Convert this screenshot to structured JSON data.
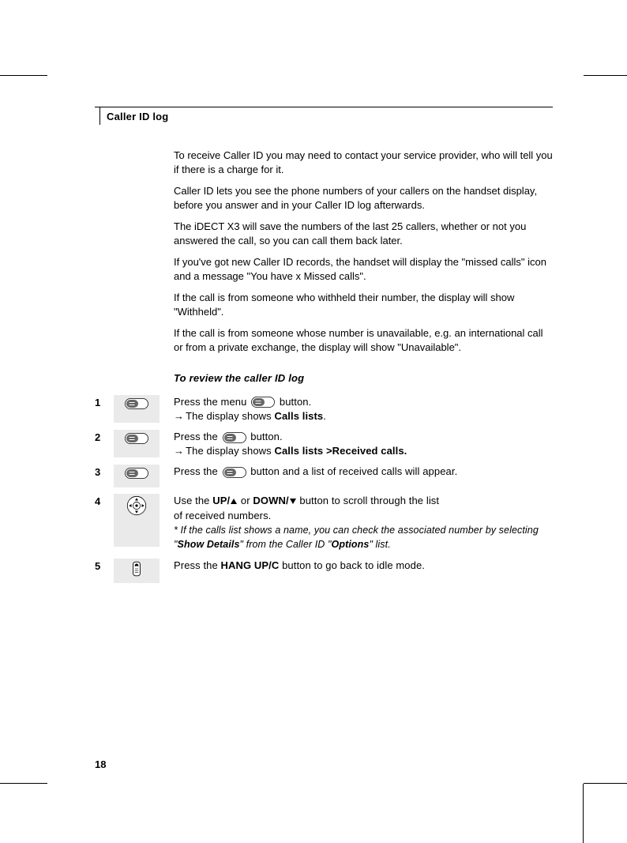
{
  "header": {
    "title": "Caller ID log"
  },
  "intro": {
    "p1": "To receive Caller ID you may need to contact your service provider, who will tell you if there is a charge for it.",
    "p2": "Caller ID lets you see the phone numbers of your callers on the handset display, before you answer and in your Caller ID log afterwards.",
    "p3": "The iDECT X3 will save the numbers of the last 25 callers, whether or not you answered the call, so you can call them back later.",
    "p4": "If you've got new Caller ID records, the handset will display the \"missed calls\" icon and a message \"You have x Missed calls\".",
    "p5": "If the call is from someone who withheld their number, the display will show \"Withheld\".",
    "p6": "If the call is from someone whose number is unavailable, e.g. an international call or from a private exchange, the display will show \"Unavailable\"."
  },
  "subhead": "To review the caller ID log",
  "steps": {
    "s1": {
      "num": "1",
      "a": "Press the menu ",
      "b": " button.",
      "c": "The display shows ",
      "d": "Calls lists",
      "e": "."
    },
    "s2": {
      "num": "2",
      "a": "Press the ",
      "b": " button.",
      "c": "The display shows ",
      "d": "Calls lists >Received calls."
    },
    "s3": {
      "num": "3",
      "a": "Press the ",
      "b": " button and a list of received calls will appear."
    },
    "s4": {
      "num": "4",
      "a": "Use the ",
      "up": "UP/",
      "mid": " or ",
      "down": "DOWN/",
      "b": " button to scroll through the list",
      "c": "of received numbers.",
      "note1": "* If the calls list shows a name, you can check the associated number by selecting \"",
      "note_b1": "Show Details",
      "note2": "\" from the Caller ID \"",
      "note_b2": "Options",
      "note3": "\" list."
    },
    "s5": {
      "num": "5",
      "a": "Press the ",
      "b": "HANG UP/C",
      "c": " button to go back to idle mode."
    }
  },
  "pageNumber": "18"
}
